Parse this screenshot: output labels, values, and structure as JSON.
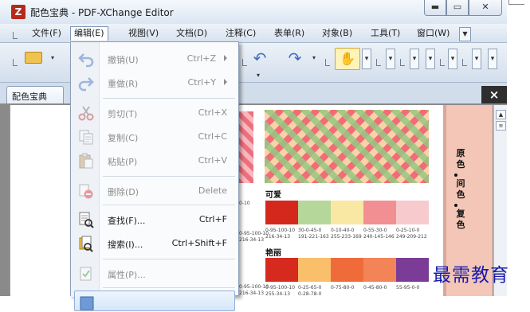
{
  "window": {
    "title": "配色宝典 - PDF-XChange Editor",
    "min_glyph": "▬",
    "max_glyph": "▭",
    "close_glyph": "✕"
  },
  "menubar": {
    "items": [
      {
        "label": "文件(F)"
      },
      {
        "label": "编辑(E)"
      },
      {
        "label": "视图(V)"
      },
      {
        "label": "文档(D)"
      },
      {
        "label": "注释(C)"
      },
      {
        "label": "表单(R)"
      },
      {
        "label": "对象(B)"
      },
      {
        "label": "工具(T)"
      },
      {
        "label": "窗口(W)"
      }
    ],
    "overflow_glyph": "▼"
  },
  "toolbar": {
    "undo_glyph": "↶",
    "redo_glyph": "↷",
    "hand_glyph": "✋",
    "caret_glyph": "▾"
  },
  "tabs": {
    "doc_tab": "配色宝典",
    "tab_x": "×",
    "close_all": "×"
  },
  "edit_menu": {
    "items": [
      {
        "label": "撤销(U)",
        "shortcut": "Ctrl+Z",
        "enabled": false,
        "submenu": true,
        "icon": "undo-icon"
      },
      {
        "label": "重做(R)",
        "shortcut": "Ctrl+Y",
        "enabled": false,
        "submenu": true,
        "icon": "redo-icon"
      },
      {
        "label": "剪切(T)",
        "shortcut": "Ctrl+X",
        "enabled": false,
        "submenu": false,
        "icon": "scissors-icon"
      },
      {
        "label": "复制(C)",
        "shortcut": "Ctrl+C",
        "enabled": false,
        "submenu": false,
        "icon": "copy-icon"
      },
      {
        "label": "粘贴(P)",
        "shortcut": "Ctrl+V",
        "enabled": false,
        "submenu": false,
        "icon": "paste-icon"
      },
      {
        "label": "删除(D)",
        "shortcut": "Delete",
        "enabled": false,
        "submenu": false,
        "icon": "delete-icon"
      },
      {
        "label": "查找(F)...",
        "shortcut": "Ctrl+F",
        "enabled": true,
        "submenu": false,
        "icon": "find-icon"
      },
      {
        "label": "搜索(I)...",
        "shortcut": "Ctrl+Shift+F",
        "enabled": true,
        "submenu": false,
        "icon": "search-icon"
      },
      {
        "label": "属性(P)...",
        "shortcut": "",
        "enabled": false,
        "submenu": false,
        "icon": "properties-icon"
      }
    ]
  },
  "document": {
    "section1_title": "可爱",
    "section2_title": "艳丽",
    "left_codes": [
      "0-95-100-10",
      "216-34-13"
    ],
    "left_codes2": [
      "0-95-100-10",
      "216-34-13"
    ],
    "top_cmyk_fragment": "0-10",
    "palette1": [
      {
        "color": "#d5281c",
        "cmyk": "0-95-100-10",
        "rgb": "216-34-13"
      },
      {
        "color": "#b6d79a",
        "cmyk": "30-0-45-0",
        "rgb": "191-221-163"
      },
      {
        "color": "#f9e8a4",
        "cmyk": "0-10-40-0",
        "rgb": "255-233-169"
      },
      {
        "color": "#f28f92",
        "cmyk": "0-55-30-0",
        "rgb": "240-145-146"
      },
      {
        "color": "#f7cbce",
        "cmyk": "0-25-10-0",
        "rgb": "249-209-212"
      }
    ],
    "palette2": [
      {
        "color": "#d72a1f",
        "cmyk": "0-95-100-10",
        "rgb": ""
      },
      {
        "color": "#f9bf6a",
        "cmyk": "0-25-65-0",
        "rgb": ""
      },
      {
        "color": "#ef6c3a",
        "cmyk": "0-75-80-0",
        "rgb": ""
      },
      {
        "color": "#f28458",
        "cmyk": "0-45-80-0",
        "rgb": ""
      },
      {
        "color": "#7a3c96",
        "cmyk": "55-95-0-0",
        "rgb": ""
      }
    ],
    "palette2_rgb": [
      "255-34-13",
      "0-28-78-0"
    ],
    "side_chars_top": [
      "原",
      "色"
    ],
    "side_chars_mid": [
      "间",
      "色"
    ],
    "side_chars_bottom": [
      "复",
      "色"
    ]
  },
  "watermark": "最需教育",
  "scrollbar": {
    "up_glyph": "▲",
    "mid_glyph": "≡"
  },
  "colors": {
    "accent_border": "#8fb0da",
    "window_bg": "#dfe8f3",
    "watermark": "#1a1aa8"
  }
}
